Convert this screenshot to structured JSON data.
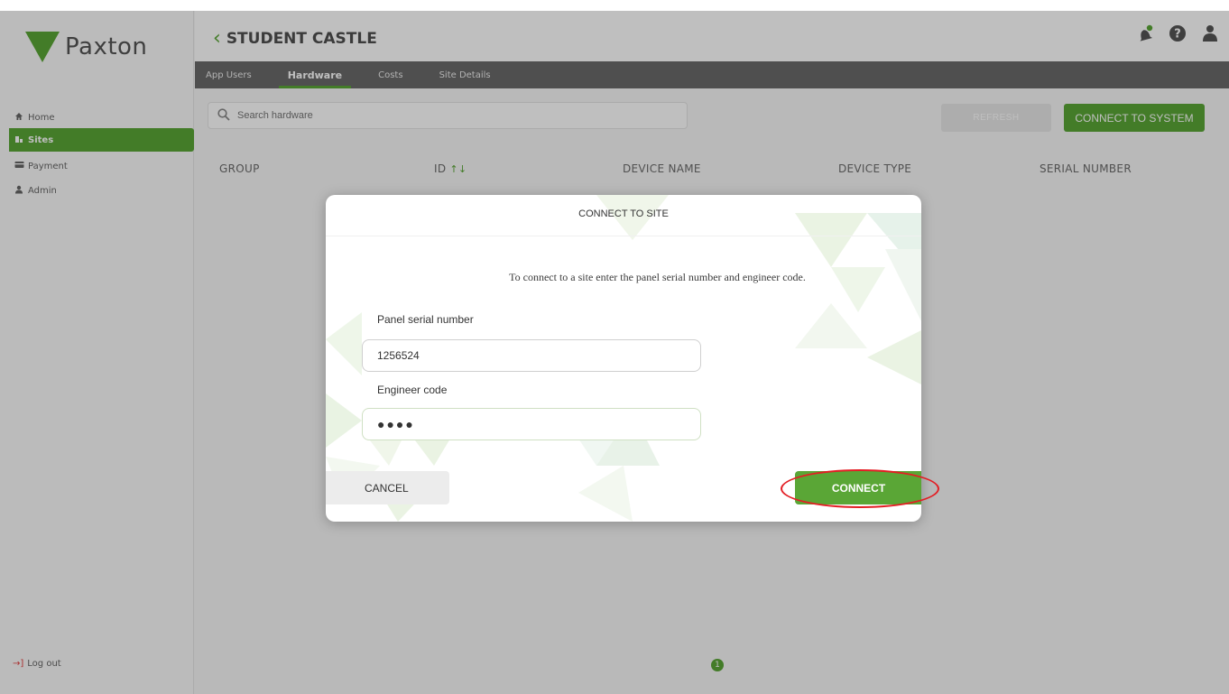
{
  "sidebar": {
    "logo": "Paxton",
    "items": [
      {
        "label": "Home",
        "icon": "home-icon"
      },
      {
        "label": "Sites",
        "icon": "building-icon"
      },
      {
        "label": "Payment",
        "icon": "card-icon"
      },
      {
        "label": "Admin",
        "icon": "user-icon"
      }
    ],
    "logout": "Log out"
  },
  "header": {
    "title": "STUDENT CASTLE"
  },
  "tabs": [
    {
      "label": "App Users"
    },
    {
      "label": "Hardware"
    },
    {
      "label": "Costs"
    },
    {
      "label": "Site Details"
    }
  ],
  "toolbar": {
    "search_placeholder": "Search hardware",
    "refresh_label": "REFRESH",
    "connect_system_label": "CONNECT TO SYSTEM"
  },
  "table": {
    "columns": [
      "GROUP",
      "ID",
      "DEVICE NAME",
      "DEVICE TYPE",
      "SERIAL NUMBER"
    ]
  },
  "pagination": {
    "current_page": "1"
  },
  "dialog": {
    "title": "CONNECT TO SITE",
    "message": "To connect to a site enter the panel serial number and engineer code.",
    "serial_label": "Panel serial number",
    "serial_value": "1256524",
    "engineer_label": "Engineer code",
    "engineer_value": "●●●●",
    "cancel_label": "CANCEL",
    "connect_label": "CONNECT"
  },
  "colors": {
    "accent": "#5aa636",
    "tabbar": "#6a6a6a",
    "highlight": "#e31e24"
  }
}
